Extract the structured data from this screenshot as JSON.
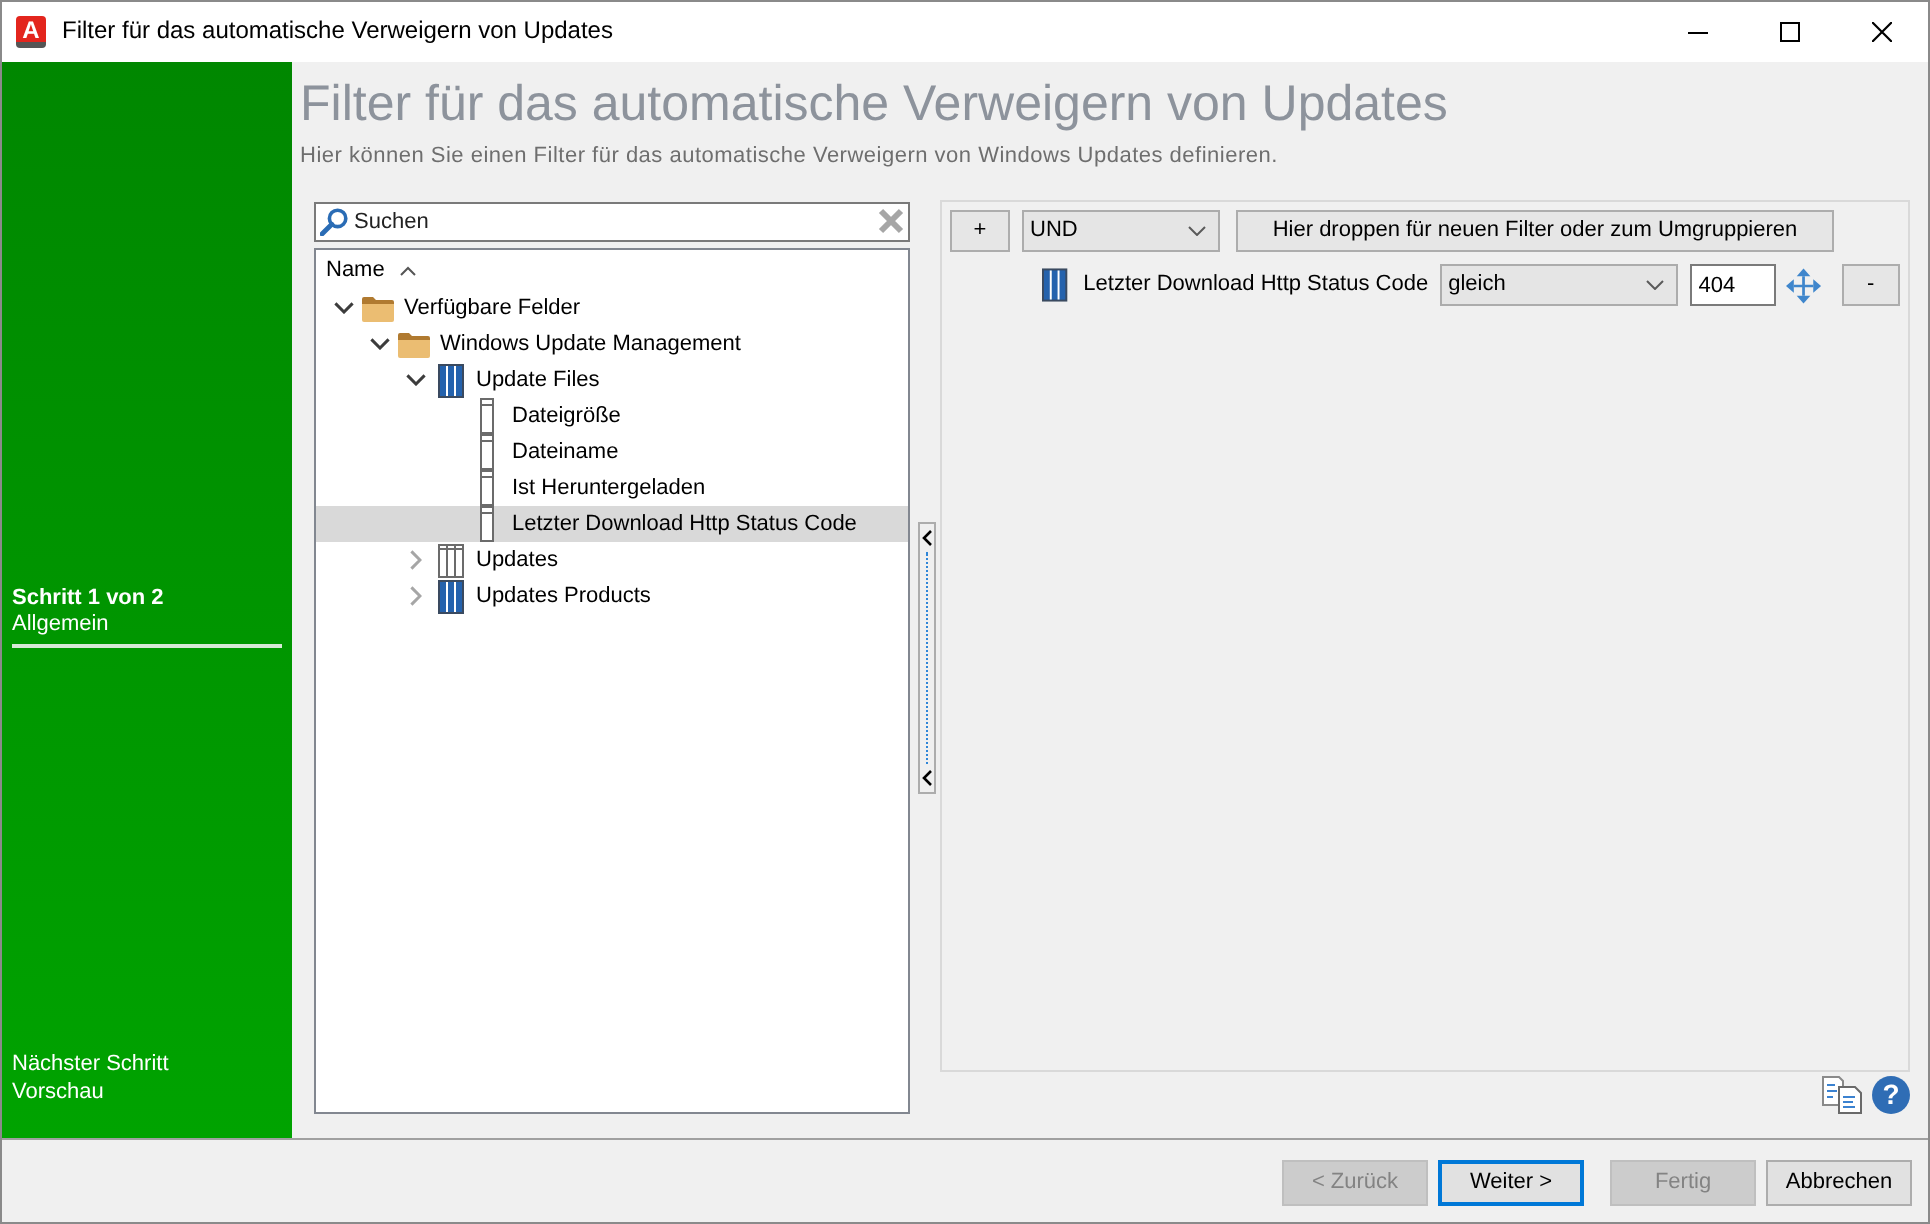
{
  "window": {
    "logo": "A",
    "title": "Filter für das automatische Verweigern von Updates"
  },
  "sidebar": {
    "step": "Schritt 1 von 2",
    "step_name": "Allgemein",
    "next_label": "Nächster Schritt",
    "next_name": "Vorschau"
  },
  "header": {
    "title": "Filter für das automatische Verweigern von Updates",
    "subtitle": "Hier können Sie einen Filter für das automatische Verweigern von Windows Updates definieren."
  },
  "search": {
    "placeholder": "Suchen"
  },
  "tree": {
    "column": "Name",
    "items": [
      {
        "label": "Verfügbare Felder",
        "kind": "folder",
        "expanded": true,
        "selected": false,
        "children": [
          {
            "label": "Windows Update Management",
            "kind": "folder",
            "expanded": true,
            "selected": false,
            "children": [
              {
                "label": "Update Files",
                "kind": "table",
                "expanded": true,
                "selected": false,
                "children": [
                  {
                    "label": "Dateigröße",
                    "kind": "field",
                    "selected": false
                  },
                  {
                    "label": "Dateiname",
                    "kind": "field",
                    "selected": false
                  },
                  {
                    "label": "Ist Heruntergeladen",
                    "kind": "field",
                    "selected": false
                  },
                  {
                    "label": "Letzter Download Http Status Code",
                    "kind": "field",
                    "selected": true
                  }
                ]
              },
              {
                "label": "Updates",
                "kind": "table-outline",
                "expanded": false,
                "selected": false
              },
              {
                "label": "Updates Products",
                "kind": "table",
                "expanded": false,
                "selected": false
              }
            ]
          }
        ]
      }
    ]
  },
  "filter": {
    "add_label": "+",
    "operator": "UND",
    "drop_label": "Hier droppen für neuen Filter oder zum Umgruppieren",
    "conditions": [
      {
        "field": "Letzter Download Http Status Code",
        "comparison": "gleich",
        "value": "404",
        "remove_label": "-"
      }
    ]
  },
  "help_button": "?",
  "buttons": [
    {
      "label": "< Zurück",
      "disabled": true,
      "default": false
    },
    {
      "label": "Weiter >",
      "disabled": false,
      "default": true
    },
    {
      "label": "Fertig",
      "disabled": true,
      "default": false
    },
    {
      "label": "Abbrechen",
      "disabled": false,
      "default": false
    }
  ]
}
